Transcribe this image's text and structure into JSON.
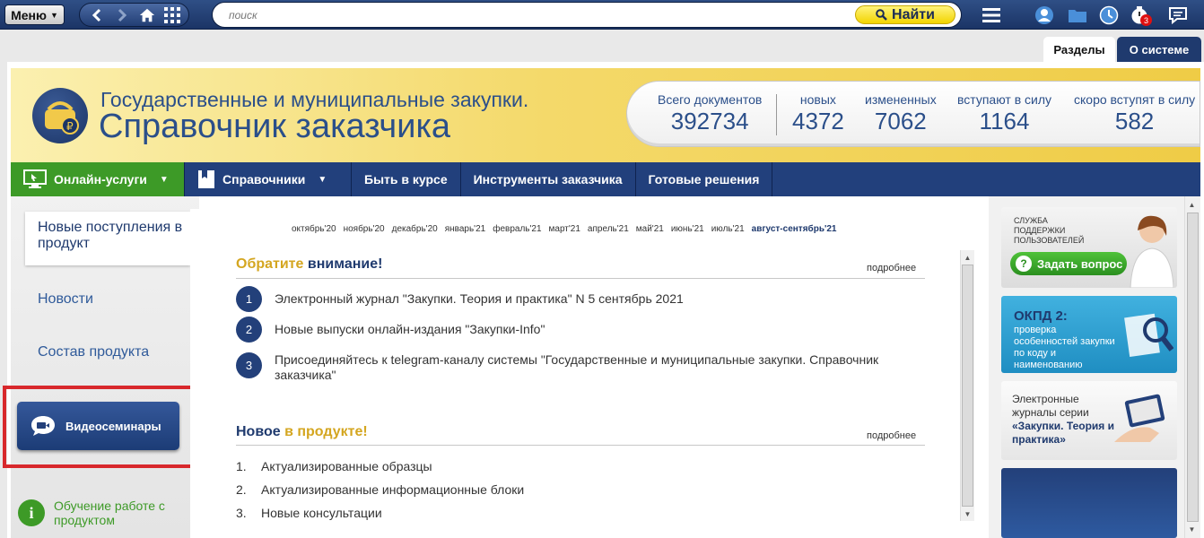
{
  "toolbar": {
    "menu_label": "Меню",
    "search_placeholder": "поиск",
    "find_label": "Найти",
    "notification_count": "3"
  },
  "tabs": {
    "sections": "Разделы",
    "about": "О системе"
  },
  "banner": {
    "title": "Государственные и муниципальные закупки.",
    "subtitle": "Справочник заказчика",
    "stats": [
      {
        "label": "Всего документов",
        "value": "392734"
      },
      {
        "label": "новых",
        "value": "4372"
      },
      {
        "label": "измененных",
        "value": "7062"
      },
      {
        "label": "вступают в силу",
        "value": "1164"
      },
      {
        "label": "скоро вступят в силу",
        "value": "582"
      }
    ]
  },
  "nav": [
    {
      "label": "Онлайн-услуги"
    },
    {
      "label": "Справочники"
    },
    {
      "label": "Быть в курсе"
    },
    {
      "label": "Инструменты заказчика"
    },
    {
      "label": "Готовые решения"
    }
  ],
  "sidebar": {
    "active": "Новые поступления в продукт",
    "items": [
      "Новости",
      "Состав продукта"
    ],
    "video_button": "Видеосеминары",
    "training": "Обучение работе с продуктом"
  },
  "months": [
    "октябрь'20",
    "ноябрь'20",
    "декабрь'20",
    "январь'21",
    "февраль'21",
    "март'21",
    "апрель'21",
    "май'21",
    "июнь'21",
    "июль'21",
    "август-сентябрь'21"
  ],
  "attention": {
    "title_a": "Обратите",
    "title_b": "внимание!",
    "more": "подробнее",
    "items": [
      {
        "num": "1",
        "text": "Электронный журнал \"Закупки. Теория и практика\" N 5 сентябрь 2021"
      },
      {
        "num": "2",
        "text": "Новые выпуски онлайн-издания \"Закупки-Info\""
      },
      {
        "num": "3",
        "text": "Присоединяйтесь к telegram-каналу системы \"Государственные и муниципальные закупки. Справочник заказчика\""
      }
    ]
  },
  "new_in_product": {
    "title_a": "Новое",
    "title_b": "в продукте!",
    "more": "подробнее",
    "items": [
      {
        "num": "1.",
        "text": "Актуализированные образцы"
      },
      {
        "num": "2.",
        "text": "Актуализированные информационные блоки"
      },
      {
        "num": "3.",
        "text": "Новые консультации"
      }
    ]
  },
  "right": {
    "support_text": "СЛУЖБА ПОДДЕРЖКИ ПОЛЬЗОВАТЕЛЕЙ",
    "ask_button": "Задать вопрос",
    "okpd_title": "ОКПД 2:",
    "okpd_text": "проверка особенностей закупки по коду и наименованию",
    "journals_text_a": "Электронные журналы серии",
    "journals_text_b": "«Закупки. Теория и практика»"
  },
  "colors": {
    "navy": "#1f3a6e",
    "gold": "#d4a620",
    "green": "#3d9a27",
    "highlight": "#d8282c"
  }
}
